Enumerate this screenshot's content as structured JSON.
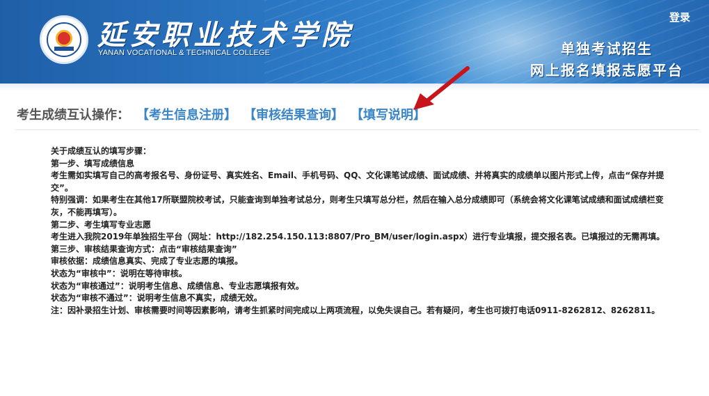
{
  "header": {
    "school_name_cn": "延安职业技术学院",
    "school_name_en": "YANAN VOCATIONAL & TECHNICAL COLLEGE",
    "login_label": "登录",
    "platform_title_line1": "单独考试招生",
    "platform_title_line2": "网上报名填报志愿平台"
  },
  "ops": {
    "label": "考生成绩互认操作：",
    "links": [
      {
        "label": "【考生信息注册】"
      },
      {
        "label": "【审核结果查询】"
      },
      {
        "label": "【填写说明】"
      }
    ]
  },
  "instructions": [
    "关于成绩互认的填写步骤：",
    "第一步、填写成绩信息",
    "考生需如实填写自己的高考报名号、身份证号、真实姓名、Email、手机号码、QQ、文化课笔试成绩、面试成绩、并将真实的成绩单以图片形式上传，点击“保存并提交”。",
    "特别强调：如果考生在其他17所联盟院校考试，只能查询到单独考试总分，则考生只填写总分栏，然后在输入总分成绩即可（系统会将文化课笔试成绩和面试成绩栏变灰，不能再填写）。",
    "第二步、考生填写专业志愿",
    "考生进入我院2019年单独招生平台（网址：http://182.254.150.113:8807/Pro_BM/user/login.aspx）进行专业填报，提交报名表。已填报过的无需再填。",
    "第三步、审核结果查询方式：点击“审核结果查询”",
    "审核依据：成绩信息真实、完成了专业志愿的填报。",
    "状态为“审核中”：说明在等待审核。",
    "状态为“审核通过”：说明考生信息、成绩信息、专业志愿填报有效。",
    "状态为“审核不通过”：说明考生信息不真实，成绩无效。",
    "注：因补录招生计划、审核需要时间等因素影响，请考生抓紧时间完成以上两项流程，以免失误自己。若有疑问，考生也可拨打电话0911-8262812、8262811。"
  ],
  "colors": {
    "banner_blue": "#2d7ac6",
    "link_blue": "#3a86c8",
    "arrow_red": "#c8141b"
  },
  "icons": {
    "logo": "school-emblem",
    "arrow": "red-pointer-arrow"
  }
}
